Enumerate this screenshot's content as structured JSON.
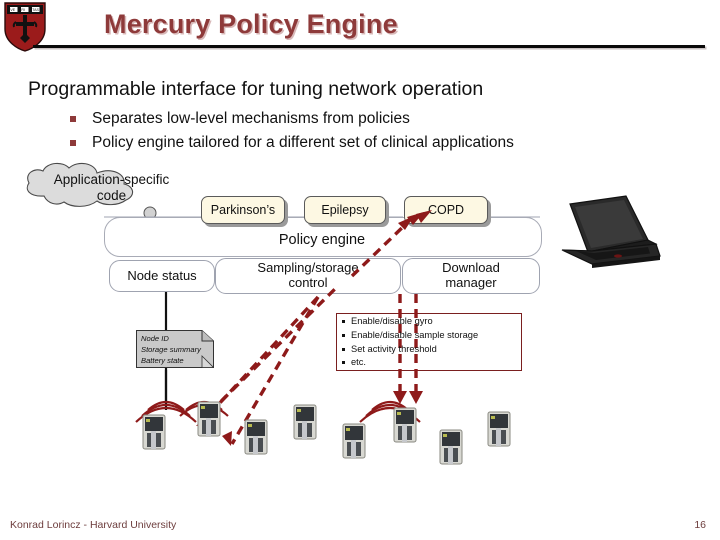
{
  "header": {
    "title": "Mercury Policy Engine",
    "logo_name": "harvard-shield-logo",
    "title_color": "#8e3a3a"
  },
  "body": {
    "lead": "Programmable interface for tuning network operation",
    "bullets": [
      "Separates low-level mechanisms from policies",
      "Policy engine tailored for a different set of clinical applications"
    ],
    "bullet_color": "#8e3a3a"
  },
  "diagram": {
    "cloud": {
      "label_line1": "Application-specific",
      "label_line2": "code",
      "fill": "#dcdcdc"
    },
    "applications": [
      {
        "label": "Parkinson’s"
      },
      {
        "label": "Epilepsy"
      },
      {
        "label": "COPD"
      }
    ],
    "engine": {
      "label": "Policy engine",
      "modules": [
        {
          "label_line1": "Node status",
          "label_line2": ""
        },
        {
          "label_line1": "Sampling/storage",
          "label_line2": "control"
        },
        {
          "label_line1": "Download",
          "label_line2": "manager"
        }
      ]
    },
    "note": {
      "lines": [
        "Node ID",
        "Storage summary",
        "Battery state"
      ],
      "fill": "#c9c9c9"
    },
    "commands": {
      "items": [
        "Enable/disable gyro",
        "Enable/disable sample storage",
        "Set activity threshold",
        "etc."
      ],
      "border_color": "#7a1f1f"
    },
    "laptop_name": "laptop-image",
    "mote_count": 8,
    "arrow_color": "#8e1a1a",
    "uplink_color": "#111111"
  },
  "footer": {
    "author": "Konrad Lorincz - Harvard University",
    "page_number": "16",
    "color": "#6d3d3d"
  }
}
